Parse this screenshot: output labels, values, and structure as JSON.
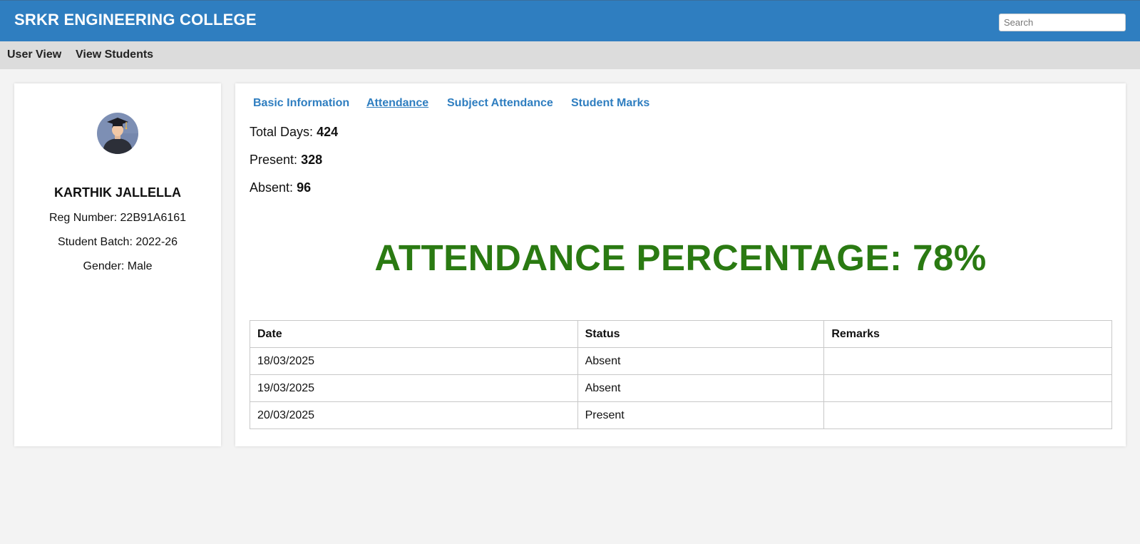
{
  "header": {
    "title": "SRKR ENGINEERING COLLEGE",
    "search_placeholder": "Search",
    "search_value": ""
  },
  "nav": {
    "items": [
      "User View",
      "View Students"
    ]
  },
  "profile": {
    "avatar_icon": "graduate-avatar-icon",
    "name": "KARTHIK JALLELLA",
    "reg_label": "Reg Number: 22B91A6161",
    "batch_label": "Student Batch: 2022-26",
    "gender_label": "Gender: Male"
  },
  "tabs": [
    {
      "label": "Basic Information",
      "active": false
    },
    {
      "label": "Attendance",
      "active": true
    },
    {
      "label": "Subject Attendance",
      "active": false
    },
    {
      "label": "Student Marks",
      "active": false
    }
  ],
  "attendance": {
    "total_days_label": "Total Days:",
    "total_days": "424",
    "present_label": "Present:",
    "present": "328",
    "absent_label": "Absent:",
    "absent": "96",
    "percentage_text": "ATTENDANCE PERCENTAGE: 78%"
  },
  "table": {
    "columns": [
      "Date",
      "Status",
      "Remarks"
    ],
    "rows": [
      {
        "date": "18/03/2025",
        "status": "Absent",
        "remarks": ""
      },
      {
        "date": "19/03/2025",
        "status": "Absent",
        "remarks": ""
      },
      {
        "date": "20/03/2025",
        "status": "Present",
        "remarks": ""
      }
    ]
  },
  "colors": {
    "header_bg": "#2f7ec0",
    "nav_bg": "#dcdcdc",
    "tab_link": "#2f7ec0",
    "percentage_green": "#2a7a12",
    "page_bg": "#f3f3f3"
  }
}
